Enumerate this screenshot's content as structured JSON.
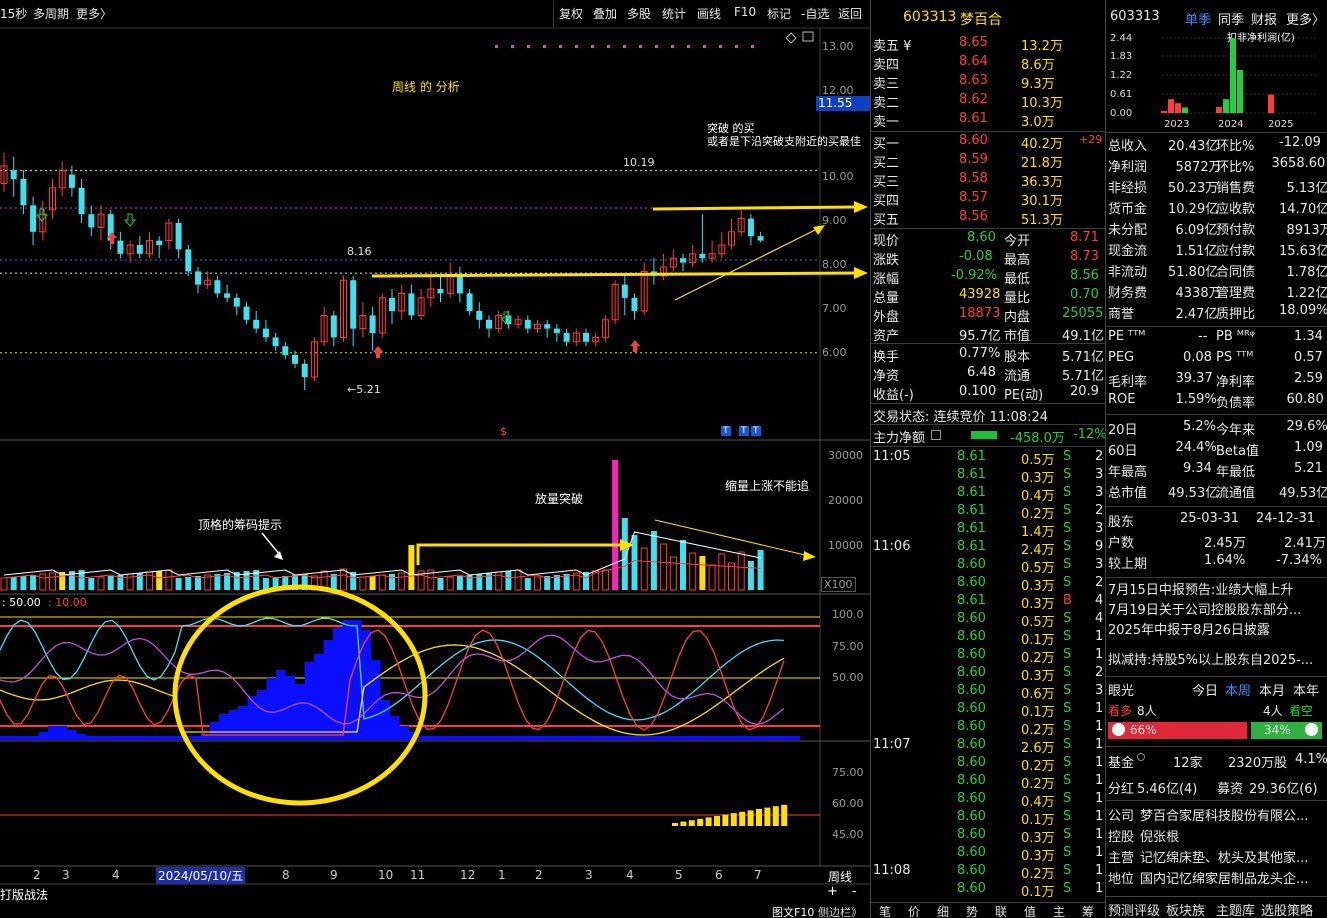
{
  "toolbar": {
    "left": [
      "15秒",
      "多周期",
      "更多〉"
    ],
    "right": [
      "复权",
      "叠加",
      "多股",
      "统计",
      "画线",
      "F10",
      "标记",
      "-自选",
      "返回"
    ]
  },
  "chart": {
    "price_ticks": [
      "13.00",
      "12.00",
      "11.00",
      "10.00",
      "9.00",
      "8.00",
      "7.00",
      "6.00"
    ],
    "current_price_tag": "11.55",
    "level_1019": "10.19",
    "level_816": "8.16",
    "low_label": "←5.21",
    "vol_ticks": [
      "30000",
      "20000",
      "10000"
    ],
    "vol_unit": "X100",
    "ind_ticks": [
      "100.0",
      "75.00",
      "50.00"
    ],
    "ind2_ticks": [
      "75.00",
      "60.00",
      "45.00"
    ],
    "ind_label_a": ": 50.00",
    "ind_label_b": ": 10.00",
    "period_btn": "周线",
    "date_labels": [
      "2",
      "3",
      "4",
      "7",
      "8",
      "9",
      "10",
      "11",
      "12",
      "1",
      "2",
      "3",
      "4",
      "5",
      "6",
      "7"
    ],
    "date_highlight": "2024/05/10/五",
    "bottom_left": "打版战法",
    "bottom_right": "图文F10",
    "sidebar_toggle": "侧边栏》",
    "marker_s": "$",
    "marker_t": "T",
    "plus": "+",
    "minus": "-"
  },
  "annotations": {
    "weekly": "周线     的  分析",
    "breakout_buy": "突破  的买",
    "breakout_buy2": "或者是下沿突破支附近的买最佳",
    "volume_break": "放量突破",
    "shrink": "缩量上涨不能追",
    "chip_hint": "顶格的筹码提示"
  },
  "quote": {
    "code": "603313",
    "name": "梦百合",
    "asks": [
      {
        "label": "卖五 ¥",
        "price": "8.65",
        "vol": "13.2万"
      },
      {
        "label": "卖四",
        "price": "8.64",
        "vol": "8.6万"
      },
      {
        "label": "卖三",
        "price": "8.63",
        "vol": "9.3万"
      },
      {
        "label": "卖二",
        "price": "8.62",
        "vol": "10.3万"
      },
      {
        "label": "卖一",
        "price": "8.61",
        "vol": "3.0万"
      }
    ],
    "bids": [
      {
        "label": "买一",
        "price": "8.60",
        "vol": "40.2万",
        "chg": "+29"
      },
      {
        "label": "买二",
        "price": "8.59",
        "vol": "21.8万",
        "chg": ""
      },
      {
        "label": "买三",
        "price": "8.58",
        "vol": "36.3万",
        "chg": ""
      },
      {
        "label": "买四",
        "price": "8.57",
        "vol": "30.1万",
        "chg": ""
      },
      {
        "label": "买五",
        "price": "8.56",
        "vol": "51.3万",
        "chg": ""
      }
    ],
    "stats": [
      {
        "l1": "现价",
        "v1": "8.60",
        "l2": "今开",
        "v2": "8.71",
        "c1": "green",
        "c2": "red"
      },
      {
        "l1": "涨跌",
        "v1": "-0.08",
        "l2": "最高",
        "v2": "8.73",
        "c1": "green",
        "c2": "red"
      },
      {
        "l1": "涨幅",
        "v1": "-0.92%",
        "l2": "最低",
        "v2": "8.56",
        "c1": "green",
        "c2": "green"
      },
      {
        "l1": "总量",
        "v1": "43928",
        "l2": "量比",
        "v2": "0.70",
        "c1": "yel",
        "c2": "green"
      },
      {
        "l1": "外盘",
        "v1": "18873",
        "l2": "内盘",
        "v2": "25055",
        "c1": "red",
        "c2": "green"
      },
      {
        "l1": "资产",
        "v1": "95.7亿",
        "l2": "市值",
        "v2": "49.1亿",
        "c1": "wht",
        "c2": "wht"
      }
    ],
    "stats2": [
      {
        "l1": "换手",
        "v1": "0.77%",
        "l2": "股本",
        "v2": "5.71亿"
      },
      {
        "l1": "净资",
        "v1": "6.48",
        "l2": "流通",
        "v2": "5.71亿"
      },
      {
        "l1": "收益(-)",
        "v1": "0.100",
        "l2": "PE(动)",
        "v2": "20.9"
      }
    ],
    "trade_state": "交易状态: 连续竞价 11:08:24",
    "net_inflow_label": "主力净额",
    "net_inflow": "-458.0万",
    "net_inflow_pct": "-12%",
    "ticks": [
      {
        "t": "11:05",
        "p": "8.61",
        "v": "0.5万",
        "s": "S",
        "n": "2"
      },
      {
        "t": "",
        "p": "8.61",
        "v": "0.3万",
        "s": "S",
        "n": "3"
      },
      {
        "t": "",
        "p": "8.61",
        "v": "0.4万",
        "s": "S",
        "n": "3"
      },
      {
        "t": "",
        "p": "8.61",
        "v": "0.2万",
        "s": "S",
        "n": "2"
      },
      {
        "t": "",
        "p": "8.61",
        "v": "1.4万",
        "s": "S",
        "n": "3"
      },
      {
        "t": "11:06",
        "p": "8.61",
        "v": "2.4万",
        "s": "S",
        "n": "9"
      },
      {
        "t": "",
        "p": "8.60",
        "v": "0.5万",
        "s": "S",
        "n": "3"
      },
      {
        "t": "",
        "p": "8.60",
        "v": "0.3万",
        "s": "S",
        "n": "2"
      },
      {
        "t": "",
        "p": "8.61",
        "v": "0.3万",
        "s": "B",
        "n": "4"
      },
      {
        "t": "",
        "p": "8.60",
        "v": "0.5万",
        "s": "S",
        "n": "4"
      },
      {
        "t": "",
        "p": "8.60",
        "v": "0.1万",
        "s": "S",
        "n": "1"
      },
      {
        "t": "",
        "p": "8.60",
        "v": "0.2万",
        "s": "S",
        "n": "1"
      },
      {
        "t": "",
        "p": "8.60",
        "v": "0.3万",
        "s": "S",
        "n": "2"
      },
      {
        "t": "",
        "p": "8.60",
        "v": "0.6万",
        "s": "S",
        "n": "3"
      },
      {
        "t": "",
        "p": "8.60",
        "v": "0.1万",
        "s": "S",
        "n": "1"
      },
      {
        "t": "",
        "p": "8.60",
        "v": "0.2万",
        "s": "S",
        "n": "1"
      },
      {
        "t": "11:07",
        "p": "8.60",
        "v": "2.6万",
        "s": "S",
        "n": "1"
      },
      {
        "t": "",
        "p": "8.60",
        "v": "0.2万",
        "s": "S",
        "n": "1"
      },
      {
        "t": "",
        "p": "8.60",
        "v": "0.2万",
        "s": "S",
        "n": "1"
      },
      {
        "t": "",
        "p": "8.60",
        "v": "0.4万",
        "s": "S",
        "n": "1"
      },
      {
        "t": "",
        "p": "8.60",
        "v": "0.1万",
        "s": "S",
        "n": "1"
      },
      {
        "t": "",
        "p": "8.60",
        "v": "0.3万",
        "s": "S",
        "n": "1"
      },
      {
        "t": "",
        "p": "8.60",
        "v": "0.3万",
        "s": "S",
        "n": "1"
      },
      {
        "t": "11:08",
        "p": "8.60",
        "v": "0.2万",
        "s": "S",
        "n": "1"
      },
      {
        "t": "",
        "p": "8.60",
        "v": "0.1万",
        "s": "S",
        "n": "1"
      }
    ],
    "bottom_tabs": [
      "笔",
      "价",
      "细",
      "势",
      "联",
      "值",
      "主",
      "筹"
    ]
  },
  "fin": {
    "code": "603313",
    "tabs": [
      "单季",
      "同季",
      "财报",
      "更多〉"
    ],
    "chart_title": "扣非净利润(亿)",
    "chart_ticks": [
      "2.44",
      "1.83",
      "1.22",
      "0.61",
      "0.00"
    ],
    "chart_years": [
      "2023",
      "2024",
      "2025"
    ],
    "rows": [
      {
        "l1": "总收入",
        "v1": "20.43亿",
        "l2": "环比%",
        "v2": "-12.09"
      },
      {
        "l1": "净利润",
        "v1": "5872万",
        "l2": "环比%",
        "v2": "3658.60"
      },
      {
        "l1": "非经损",
        "v1": "50.23万",
        "l2": "销售费",
        "v2": "5.13亿"
      },
      {
        "l1": "货币金",
        "v1": "10.29亿",
        "l2": "应收款",
        "v2": "14.70亿"
      },
      {
        "l1": "未分配",
        "v1": "6.09亿",
        "l2": "预付款",
        "v2": "8913万"
      },
      {
        "l1": "现金流",
        "v1": "1.51亿",
        "l2": "应付款",
        "v2": "15.63亿"
      },
      {
        "l1": "非流动",
        "v1": "51.80亿",
        "l2": "合同债",
        "v2": "1.78亿"
      },
      {
        "l1": "财务费",
        "v1": "4338万",
        "l2": "管理费",
        "v2": "1.22亿"
      },
      {
        "l1": "商誉",
        "v1": "2.47亿",
        "l2": "质押比",
        "v2": "18.09%"
      }
    ],
    "rows2": [
      {
        "l1": "PE ᵀᵀᴹ",
        "v1": "--",
        "l2": "PB ᴹᴿᵠ",
        "v2": "1.34"
      },
      {
        "l1": "PEG",
        "v1": "0.08",
        "l2": "PS ᵀᵀᴹ",
        "v2": "0.57"
      },
      {
        "l1": "毛利率",
        "v1": "39.37",
        "l2": "净利率",
        "v2": "2.59"
      },
      {
        "l1": "ROE",
        "v1": "1.59%",
        "l2": "负债率",
        "v2": "60.80"
      }
    ],
    "rows3": [
      {
        "l1": "20日",
        "v1": "5.2%",
        "l2": "今年来",
        "v2": "29.6%"
      },
      {
        "l1": "60日",
        "v1": "24.4%",
        "l2": "Beta值",
        "v2": "1.09"
      },
      {
        "l1": "年最高",
        "v1": "9.34",
        "l2": "年最低",
        "v2": "5.21"
      },
      {
        "l1": "总市值",
        "v1": "49.53亿",
        "l2": "流通值",
        "v2": "49.53亿"
      }
    ],
    "holder": {
      "label": "股东",
      "d1": "25-03-31",
      "d2": "24-12-31"
    },
    "holder_rows": [
      {
        "l": "户数",
        "v1": "2.45万",
        "v2": "2.41万"
      },
      {
        "l": "较上期",
        "v1": "1.64%",
        "v2": "-7.34%"
      }
    ],
    "news": [
      "7月15日中报预告:业绩大幅上升",
      "7月19日关于公司控股股东部分...",
      "2025年中报于8月26日披露",
      "拟减持:持股5%以上股东自2025-..."
    ],
    "eye": {
      "label": "眼光",
      "tabs": [
        "今日",
        "本周",
        "本月",
        "本年"
      ]
    },
    "bull": {
      "label": "看多",
      "count": "8人",
      "bear_count": "4人",
      "bear_label": "看空",
      "bull_pct": "66%",
      "bear_pct": "34%"
    },
    "fund": {
      "l": "基金",
      "v1": "12家",
      "v2": "2320万股",
      "v3": "4.1%"
    },
    "dividend": {
      "l": "分红",
      "v1": "5.46亿(4)",
      "l2": "募资",
      "v2": "29.36亿(6)"
    },
    "company": [
      {
        "l": "公司",
        "v": "梦百合家居科技股份有限公..."
      },
      {
        "l": "控股",
        "v": "倪张根"
      },
      {
        "l": "主营",
        "v": "记忆绵床垫、枕头及其他家..."
      },
      {
        "l": "地位",
        "v": "国内记忆绵家居制品龙头企..."
      }
    ],
    "bottom": [
      "预测评级",
      "板块族",
      "主题库",
      "选股策略"
    ]
  },
  "colors": {
    "up": "#ff3b3b",
    "down": "#3fe0ef",
    "accent": "#ffe000",
    "blue": "#0000ff"
  }
}
